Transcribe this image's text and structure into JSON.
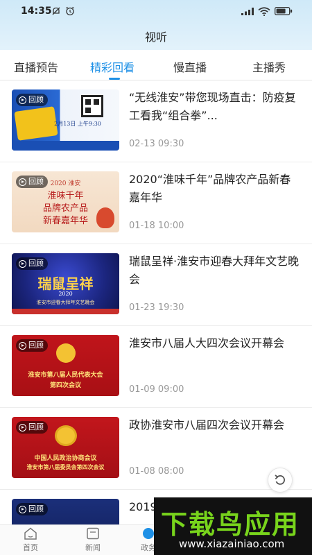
{
  "status_bar": {
    "time": "14:35"
  },
  "header": {
    "title": "视听"
  },
  "tabs": [
    {
      "label": "直播预告"
    },
    {
      "label": "精彩回看"
    },
    {
      "label": "慢直播"
    },
    {
      "label": "主播秀"
    }
  ],
  "replay_badge": "回顾",
  "items": [
    {
      "title": "“无线淮安”带您现场直击：防疫复工看我“组合拳”...",
      "time": "02-13 09:30",
      "thumb_text": [
        "2月13日 上午9:30"
      ]
    },
    {
      "title": "2020“淮味千年”品牌农产品新春嘉年华",
      "time": "01-18 10:00",
      "thumb_text": [
        "2020 淮安",
        "淮味千年",
        "品牌农产品",
        "新春嘉年华"
      ]
    },
    {
      "title": "瑞鼠呈祥·淮安市迎春大拜年文艺晚会",
      "time": "01-23 19:30",
      "thumb_text": [
        "瑞鼠呈祥",
        "2020",
        "淮安市迎春大拜年文艺晚会"
      ]
    },
    {
      "title": "淮安市八届人大四次会议开幕会",
      "time": "01-09 09:00",
      "thumb_text": [
        "淮安市第八届人民代表大会",
        "第四次会议"
      ]
    },
    {
      "title": "政协淮安市八届四次会议开幕会",
      "time": "01-08 08:00",
      "thumb_text": [
        "中国人民政治协商会议",
        "淮安市第八届委员会第四次会议"
      ]
    },
    {
      "title": "2019",
      "time": ""
    }
  ],
  "bottom_nav": [
    {
      "label": "首页"
    },
    {
      "label": "新闻"
    },
    {
      "label": "政务"
    }
  ],
  "watermark": {
    "main": "下载鸟应用",
    "url": "www.xiazainiao.com"
  },
  "colors": {
    "accent": "#1e90e6",
    "header_bg": "#d9eefa",
    "watermark_green": "#78d41c"
  }
}
